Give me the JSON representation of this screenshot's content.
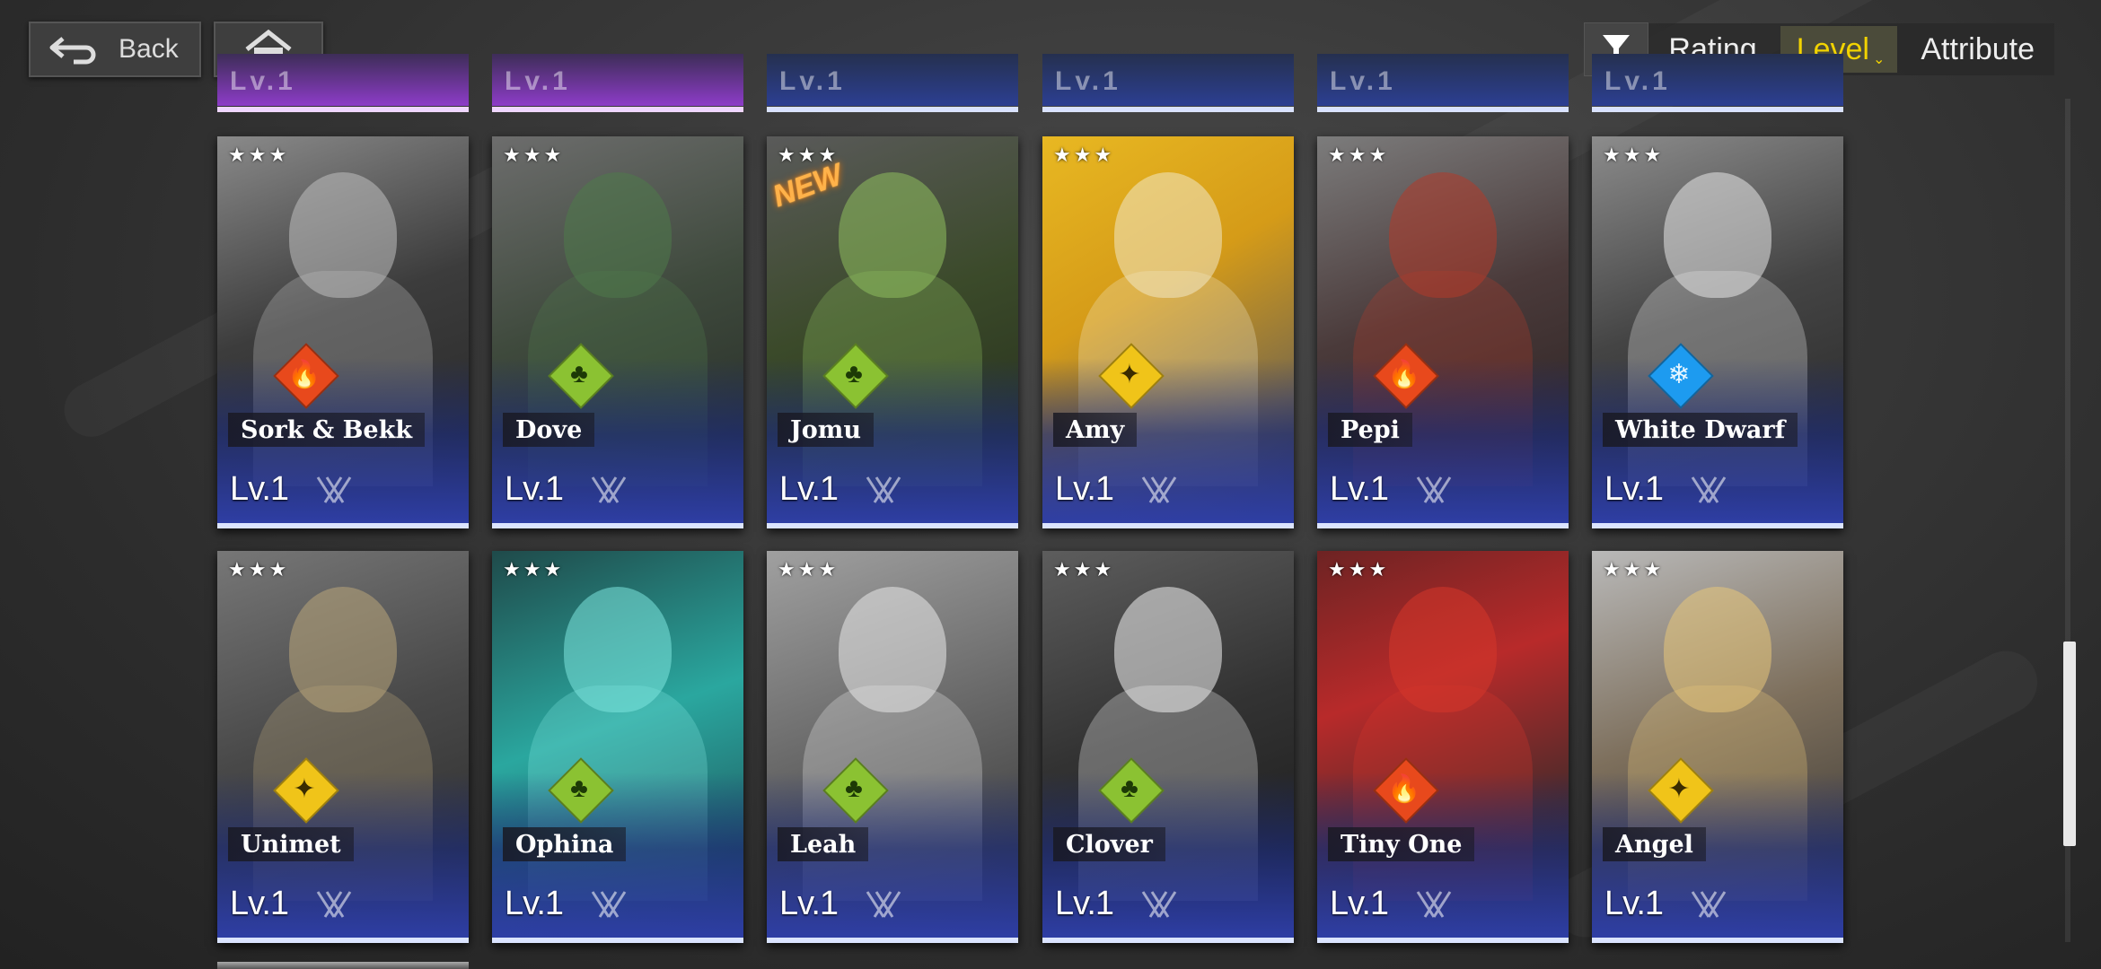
{
  "nav": {
    "back_label": "Back"
  },
  "sort": {
    "options": [
      {
        "label": "Rating",
        "active": false
      },
      {
        "label": "Level",
        "active": true
      },
      {
        "label": "Attribute",
        "active": false
      }
    ]
  },
  "partial_row": {
    "level_text": "Lv.1"
  },
  "characters": [
    {
      "name": "Sork & Bekk",
      "stars": "★★★",
      "attribute": "fire",
      "level": "Lv.1",
      "is_new": false,
      "new_label": ""
    },
    {
      "name": "Dove",
      "stars": "★★★",
      "attribute": "nature",
      "level": "Lv.1",
      "is_new": false,
      "new_label": ""
    },
    {
      "name": "Jomu",
      "stars": "★★★",
      "attribute": "nature",
      "level": "Lv.1",
      "is_new": true,
      "new_label": "NEW"
    },
    {
      "name": "Amy",
      "stars": "★★★",
      "attribute": "light",
      "level": "Lv.1",
      "is_new": false,
      "new_label": ""
    },
    {
      "name": "Pepi",
      "stars": "★★★",
      "attribute": "fire",
      "level": "Lv.1",
      "is_new": false,
      "new_label": ""
    },
    {
      "name": "White Dwarf",
      "stars": "★★★",
      "attribute": "ice",
      "level": "Lv.1",
      "is_new": false,
      "new_label": ""
    },
    {
      "name": "Unimet",
      "stars": "★★★",
      "attribute": "light",
      "level": "Lv.1",
      "is_new": false,
      "new_label": ""
    },
    {
      "name": "Ophina",
      "stars": "★★★",
      "attribute": "nature",
      "level": "Lv.1",
      "is_new": false,
      "new_label": ""
    },
    {
      "name": "Leah",
      "stars": "★★★",
      "attribute": "nature",
      "level": "Lv.1",
      "is_new": false,
      "new_label": ""
    },
    {
      "name": "Clover",
      "stars": "★★★",
      "attribute": "nature",
      "level": "Lv.1",
      "is_new": false,
      "new_label": ""
    },
    {
      "name": "Tiny One",
      "stars": "★★★",
      "attribute": "fire",
      "level": "Lv.1",
      "is_new": false,
      "new_label": ""
    },
    {
      "name": "Angel",
      "stars": "★★★",
      "attribute": "light",
      "level": "Lv.1",
      "is_new": false,
      "new_label": ""
    }
  ],
  "attribute_icons": {
    "fire": "fire-icon",
    "nature": "leaf-tree-icon",
    "light": "spark-icon",
    "ice": "snowflake-icon"
  },
  "colors": {
    "accent": "#f2d300",
    "fire": "#e8491c",
    "nature": "#8bc232",
    "light": "#f0c419",
    "ice": "#1d9bf0",
    "card_base": "#2f3fa8"
  }
}
